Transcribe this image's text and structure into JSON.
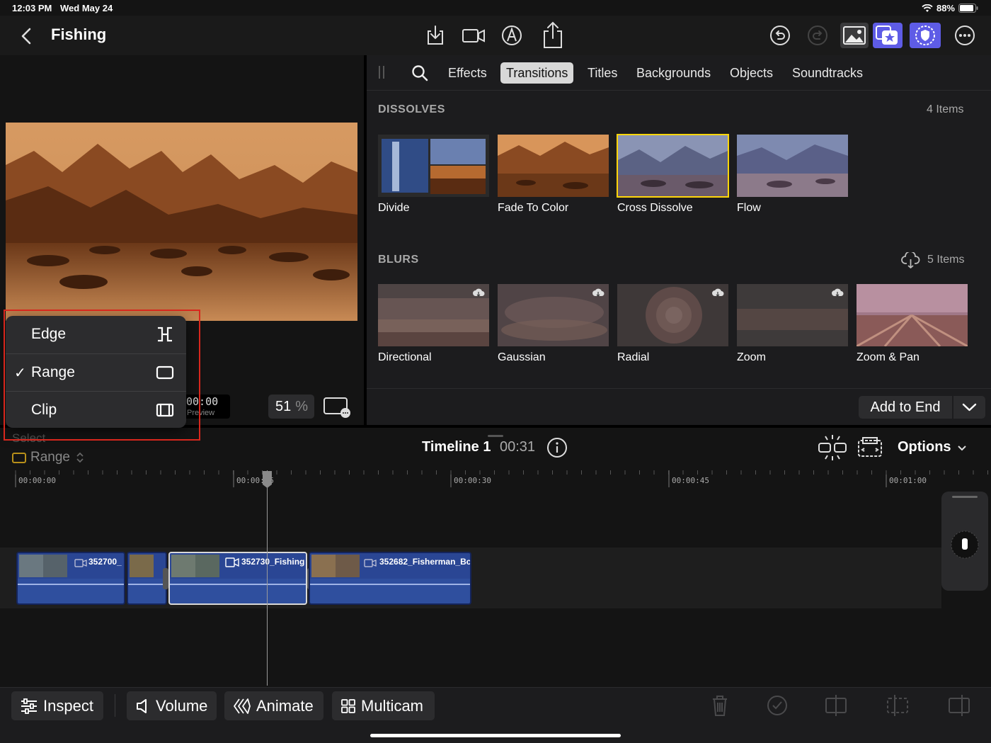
{
  "status": {
    "time": "12:03 PM",
    "date": "Wed May 24",
    "battery": "88%"
  },
  "header": {
    "title": "Fishing",
    "icons": [
      "back-chevron-icon",
      "import-icon",
      "camera-icon",
      "voiceover-icon",
      "share-icon",
      "undo-icon",
      "redo-icon",
      "photos-icon",
      "star-overlay-icon",
      "shield-icon",
      "more-icon"
    ]
  },
  "browser": {
    "tabs": [
      "Effects",
      "Transitions",
      "Titles",
      "Backgrounds",
      "Objects",
      "Soundtracks"
    ],
    "active_tab": "Transitions",
    "sections": [
      {
        "title": "DISSOLVES",
        "count": "4 Items",
        "items": [
          "Divide",
          "Fade To Color",
          "Cross Dissolve",
          "Flow"
        ],
        "selected": "Cross Dissolve"
      },
      {
        "title": "BLURS",
        "count": "5 Items",
        "items": [
          "Directional",
          "Gaussian",
          "Radial",
          "Zoom",
          "Zoom & Pan"
        ]
      }
    ],
    "add_button": "Add to End"
  },
  "viewer": {
    "timecode": "00:00",
    "timecode_sub": "Preview",
    "zoom_value": "51",
    "zoom_unit": "%"
  },
  "select_menu": {
    "items": [
      {
        "label": "Edge",
        "checked": false
      },
      {
        "label": "Range",
        "checked": true
      },
      {
        "label": "Clip",
        "checked": false
      }
    ],
    "check_glyph": "✓",
    "select_label": "Select",
    "current": "Range"
  },
  "timeline": {
    "title": "Timeline 1",
    "duration": "00:31",
    "options_label": "Options",
    "ruler": [
      "00:00:00",
      "00:00:15",
      "00:00:30",
      "00:00:45",
      "00:01:00"
    ],
    "clips": [
      "352700_",
      "",
      "352730_Fishing",
      "352682_Fisherman_Bc"
    ]
  },
  "toolbar": {
    "inspect": "Inspect",
    "volume": "Volume",
    "animate": "Animate",
    "multicam": "Multicam"
  },
  "colors": {
    "accent_yellow": "#ffd60a",
    "highlight_red": "#d8271d",
    "clip_blue": "#2f4f9e",
    "purple_active": "#5e5ce6"
  }
}
